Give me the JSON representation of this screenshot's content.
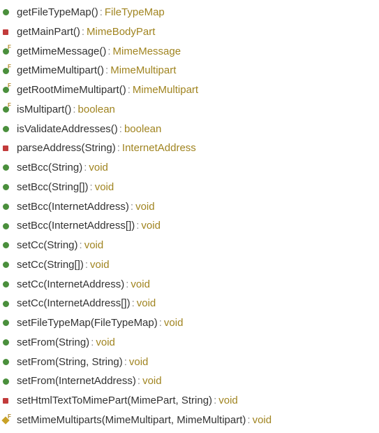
{
  "methods": [
    {
      "visibility": "public",
      "badge": "",
      "name": "getFileTypeMap()",
      "return": "FileTypeMap"
    },
    {
      "visibility": "private",
      "badge": "",
      "name": "getMainPart()",
      "return": "MimeBodyPart"
    },
    {
      "visibility": "public",
      "badge": "F",
      "name": "getMimeMessage()",
      "return": "MimeMessage"
    },
    {
      "visibility": "public",
      "badge": "F",
      "name": "getMimeMultipart()",
      "return": "MimeMultipart"
    },
    {
      "visibility": "public",
      "badge": "F",
      "name": "getRootMimeMultipart()",
      "return": "MimeMultipart"
    },
    {
      "visibility": "public",
      "badge": "F",
      "name": "isMultipart()",
      "return": "boolean"
    },
    {
      "visibility": "public",
      "badge": "",
      "name": "isValidateAddresses()",
      "return": "boolean"
    },
    {
      "visibility": "private",
      "badge": "",
      "name": "parseAddress(String)",
      "return": "InternetAddress"
    },
    {
      "visibility": "public",
      "badge": "",
      "name": "setBcc(String)",
      "return": "void"
    },
    {
      "visibility": "public",
      "badge": "",
      "name": "setBcc(String[])",
      "return": "void"
    },
    {
      "visibility": "public",
      "badge": "",
      "name": "setBcc(InternetAddress)",
      "return": "void"
    },
    {
      "visibility": "public",
      "badge": "",
      "name": "setBcc(InternetAddress[])",
      "return": "void"
    },
    {
      "visibility": "public",
      "badge": "",
      "name": "setCc(String)",
      "return": "void"
    },
    {
      "visibility": "public",
      "badge": "",
      "name": "setCc(String[])",
      "return": "void"
    },
    {
      "visibility": "public",
      "badge": "",
      "name": "setCc(InternetAddress)",
      "return": "void"
    },
    {
      "visibility": "public",
      "badge": "",
      "name": "setCc(InternetAddress[])",
      "return": "void"
    },
    {
      "visibility": "public",
      "badge": "",
      "name": "setFileTypeMap(FileTypeMap)",
      "return": "void"
    },
    {
      "visibility": "public",
      "badge": "",
      "name": "setFrom(String)",
      "return": "void"
    },
    {
      "visibility": "public",
      "badge": "",
      "name": "setFrom(String, String)",
      "return": "void"
    },
    {
      "visibility": "public",
      "badge": "",
      "name": "setFrom(InternetAddress)",
      "return": "void"
    },
    {
      "visibility": "private",
      "badge": "",
      "name": "setHtmlTextToMimePart(MimePart, String)",
      "return": "void"
    },
    {
      "visibility": "protected",
      "badge": "F",
      "name": "setMimeMultiparts(MimeMultipart, MimeMultipart)",
      "return": "void"
    }
  ],
  "separator": ":"
}
